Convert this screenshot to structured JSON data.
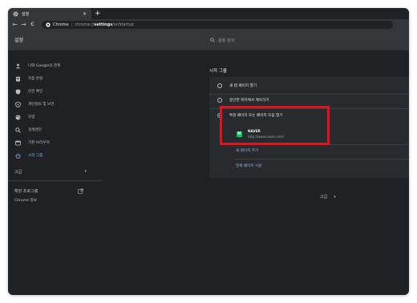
{
  "tab": {
    "title": "설정",
    "close": "×",
    "new_tab": "+"
  },
  "toolbar": {
    "back": "←",
    "forward": "→",
    "reload": "C",
    "url_site": "Chrome",
    "url_sep": "|",
    "url_prefix": "chrome://",
    "url_host": "settings",
    "url_path": "/onStartup"
  },
  "header": {
    "title": "설정",
    "search_placeholder": "설정 검색"
  },
  "sidebar": {
    "items": [
      {
        "label": "나와 Google의 관계",
        "icon": "person-icon"
      },
      {
        "label": "자동 완성",
        "icon": "clipboard-icon"
      },
      {
        "label": "안전 확인",
        "icon": "shield-icon"
      },
      {
        "label": "개인정보 및 보안",
        "icon": "lock-icon"
      },
      {
        "label": "모양",
        "icon": "palette-icon"
      },
      {
        "label": "검색엔진",
        "icon": "search-icon"
      },
      {
        "label": "기본 브라우저",
        "icon": "browser-icon"
      },
      {
        "label": "시작 그룹",
        "icon": "power-icon"
      }
    ],
    "active_index": 7,
    "advanced_label": "고급",
    "advanced_chevron": "▾",
    "extensions_label": "확장 프로그램",
    "about_label": "Chrome 정보"
  },
  "main": {
    "section_title": "시작 그룹",
    "options": [
      {
        "label": "새 탭 페이지 열기",
        "selected": false
      },
      {
        "label": "중단한 위치에서 계속하기",
        "selected": false
      },
      {
        "label": "특정 페이지 또는 페이지 모음 열기",
        "selected": true
      }
    ],
    "page": {
      "favicon_letter": "N",
      "name": "NAVER",
      "url": "http://www.naver.com/"
    },
    "add_page_label": "새 페이지 추가",
    "use_current_label": "현재 페이지 사용",
    "advanced_label": "고급",
    "advanced_chevron": "▾"
  },
  "colors": {
    "window_bg": "#202124",
    "card_bg": "#292a2d",
    "text": "#e8eaed",
    "text_secondary": "#9aa0a6",
    "accent": "#8ab4f8",
    "highlight": "#e0141e",
    "naver_green": "#03c75a"
  }
}
